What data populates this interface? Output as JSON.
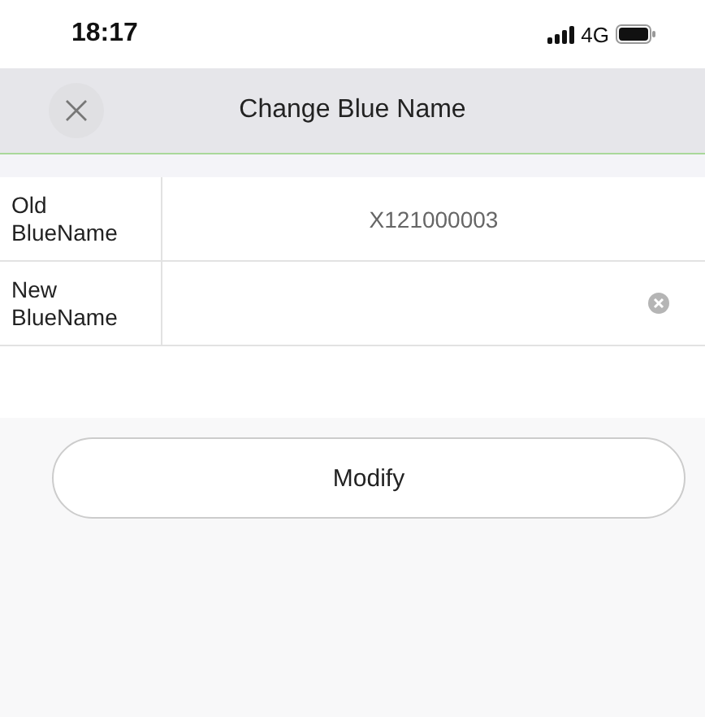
{
  "status_bar": {
    "time": "18:17",
    "network": "4G"
  },
  "header": {
    "title": "Change Blue Name"
  },
  "form_rows": [
    {
      "kind": "readonly",
      "label": "Old BlueName",
      "value": "X121000003"
    },
    {
      "kind": "input",
      "label": "New BlueName",
      "value": ""
    }
  ],
  "buttons": [
    "Modify"
  ]
}
